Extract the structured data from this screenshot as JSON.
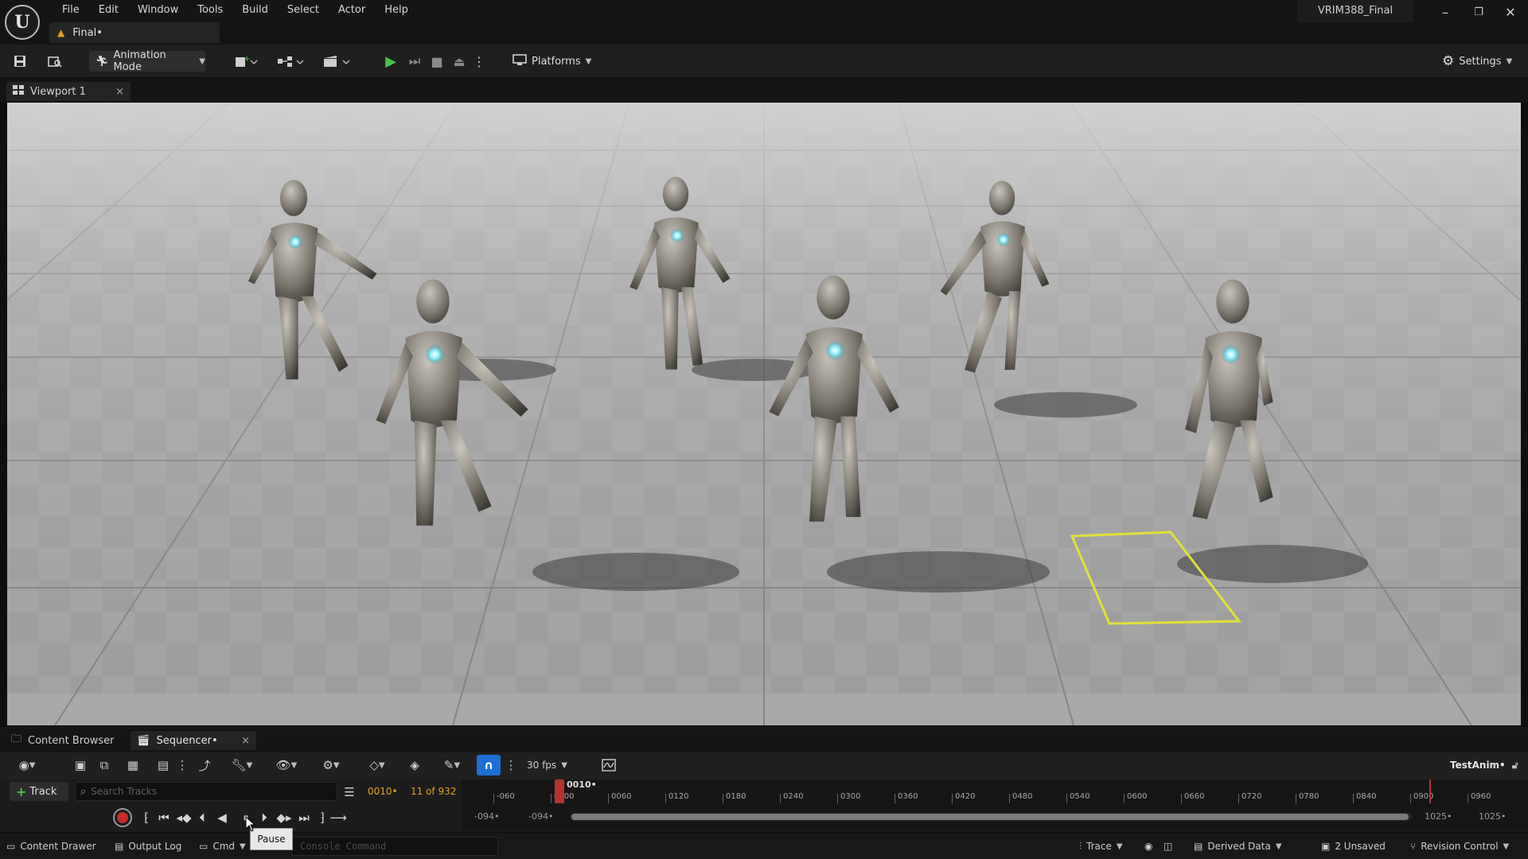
{
  "app": {
    "logo_text": "U",
    "document_tab": "Final•",
    "project_name": "VRIM388_Final",
    "window_controls": {
      "minimize": "–",
      "maximize": "❐",
      "close": "✕"
    }
  },
  "menu": [
    "File",
    "Edit",
    "Window",
    "Tools",
    "Build",
    "Select",
    "Actor",
    "Help"
  ],
  "toolbar": {
    "mode_label": "Animation Mode",
    "platforms_label": "Platforms",
    "settings_label": "Settings"
  },
  "viewport": {
    "tab_label": "Viewport 1",
    "tab_close": "×"
  },
  "dock": {
    "tabs": [
      {
        "label": "Content Browser"
      },
      {
        "label": "Sequencer•"
      }
    ],
    "tab_close": "×"
  },
  "sequencer": {
    "fps": "30 fps",
    "sequence_name": "TestAnim•",
    "add_track_label": "Track",
    "search_placeholder": "Search Tracks",
    "current_frame": "0010•",
    "frame_count": "11 of 932",
    "playhead_label": "0010•",
    "ruler_ticks": [
      "-060",
      "0000",
      "0060",
      "0120",
      "0180",
      "0240",
      "0300",
      "0360",
      "0420",
      "0480",
      "0540",
      "0600",
      "0660",
      "0720",
      "0780",
      "0840",
      "0900",
      "0960"
    ],
    "range_start": "-094•",
    "range_start_view": "-094•",
    "range_end": "1025•",
    "range_end_view": "1025•",
    "tooltip": "Pause"
  },
  "statusbar": {
    "content_drawer": "Content Drawer",
    "output_log": "Output Log",
    "cmd": "Cmd",
    "console_placeholder": "Console Command",
    "trace": "Trace",
    "derived_data": "Derived Data",
    "unsaved": "2 Unsaved",
    "revision_control": "Revision Control"
  },
  "colors": {
    "accent_blue": "#1f6fd6",
    "play_green": "#48c34b",
    "frame_orange": "#e4a223",
    "playhead_red": "#b3342d",
    "selection_yellow": "#e0e23a"
  }
}
